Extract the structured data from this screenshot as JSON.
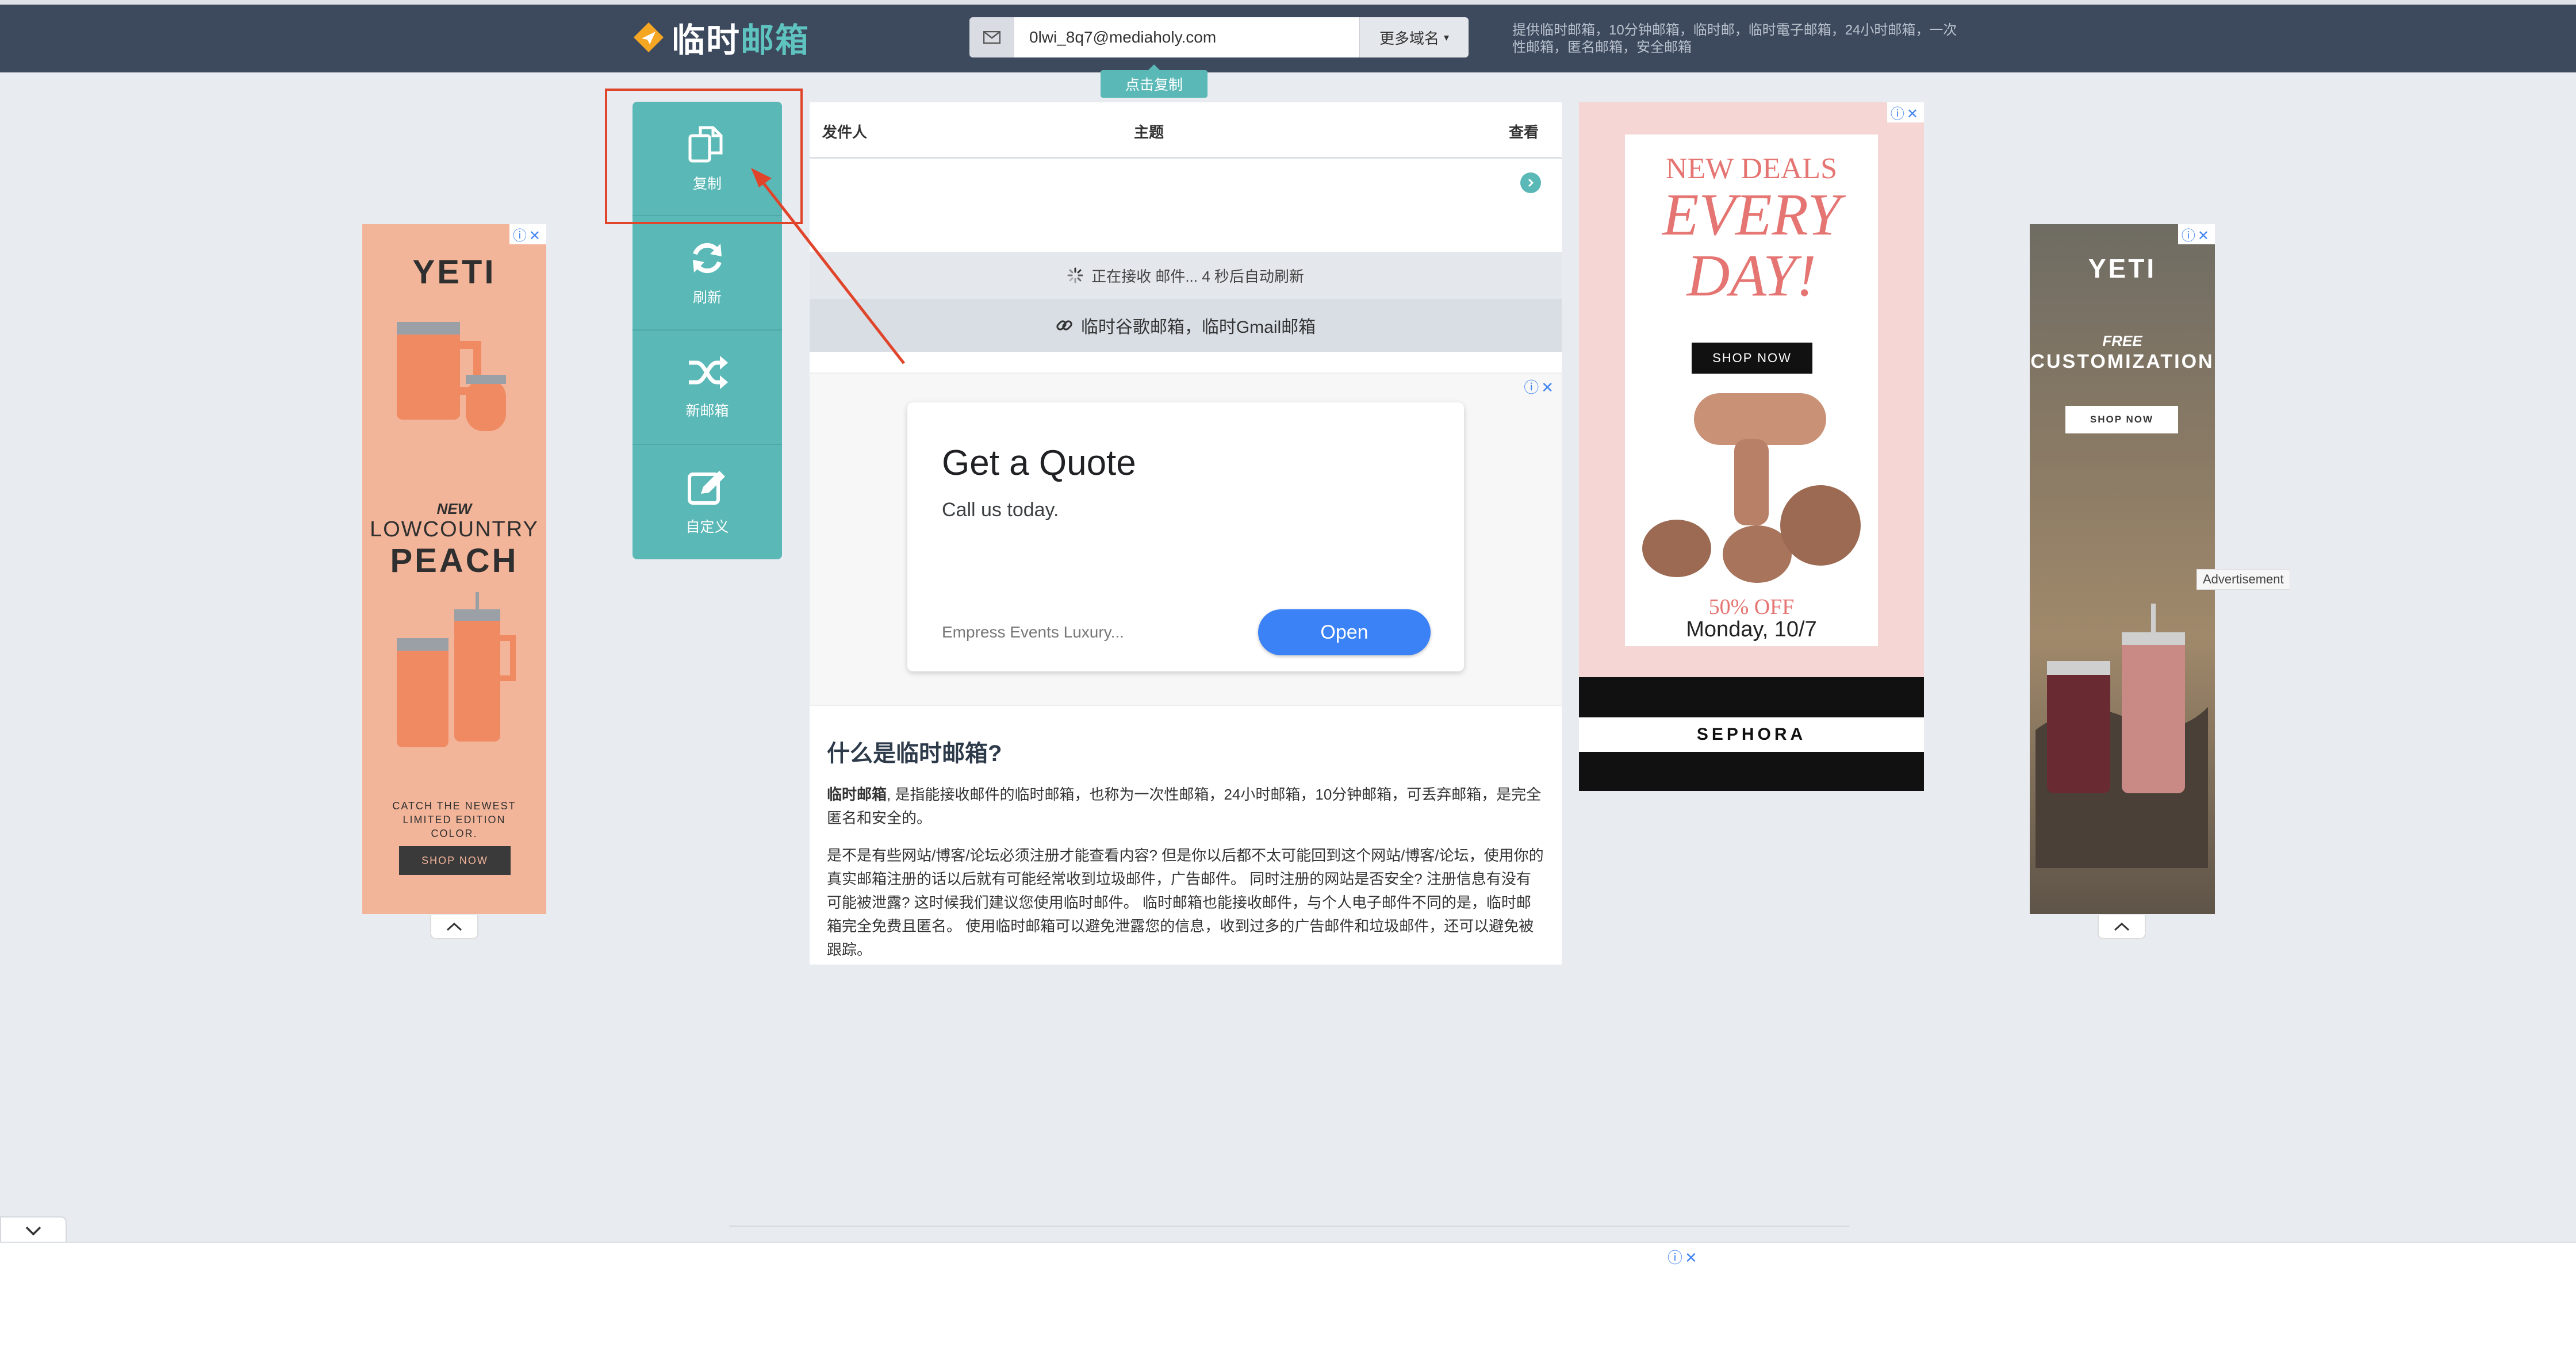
{
  "header": {
    "logo_part1": "临时",
    "logo_part2": "邮箱",
    "email_value": "0lwi_8q7@mediaholy.com",
    "more_domains": "更多域名",
    "copy_tip": "点击复制",
    "description": "提供临时邮箱，10分钟邮箱，临时邮，临时電子邮箱，24小时邮箱，一次性邮箱，匿名邮箱，安全邮箱"
  },
  "sidenav": {
    "items": [
      {
        "label": "复制",
        "icon": "copy-icon"
      },
      {
        "label": "刷新",
        "icon": "refresh-icon"
      },
      {
        "label": "新邮箱",
        "icon": "shuffle-icon"
      },
      {
        "label": "自定义",
        "icon": "edit-icon"
      }
    ]
  },
  "mail": {
    "col_from": "发件人",
    "col_subject": "主题",
    "col_view": "查看",
    "status_text": "正在接收 邮件... 4 秒后自动刷新",
    "gmail_link": "临时谷歌邮箱，临时Gmail邮箱"
  },
  "quote_ad": {
    "title": "Get a Quote",
    "subtitle": "Call us today.",
    "brand": "Empress Events Luxury...",
    "button": "Open"
  },
  "about": {
    "heading": "什么是临时邮箱?",
    "p1_bold": "临时邮箱",
    "p1_rest": ", 是指能接收邮件的临时邮箱，也称为一次性邮箱，24小时邮箱，10分钟邮箱，可丢弃邮箱，是完全匿名和安全的。",
    "p2": "是不是有些网站/博客/论坛必须注册才能查看内容? 但是你以后都不太可能回到这个网站/博客/论坛，使用你的真实邮箱注册的话以后就有可能经常收到垃圾邮件，广告邮件。 同时注册的网站是否安全? 注册信息有没有可能被泄露? 这时候我们建议您使用临时邮件。 临时邮箱也能接收邮件，与个人电子邮件不同的是，临时邮箱完全免费且匿名。 使用临时邮箱可以避免泄露您的信息，收到过多的广告邮件和垃圾邮件，还可以避免被跟踪。"
  },
  "ads": {
    "left": {
      "brand": "YETI",
      "line1": "NEW",
      "line2": "LOWCOUNTRY",
      "line3": "PEACH",
      "line4": "CATCH THE NEWEST LIMITED EDITION COLOR.",
      "cta": "SHOP NOW"
    },
    "right": {
      "brand": "YETI",
      "line1": "FREE",
      "line2": "CUSTOMIZATION",
      "cta": "SHOP NOW",
      "tag": "Advertisement"
    },
    "middle": {
      "line1": "NEW DEALS",
      "line2": "EVERY",
      "line3": "DAY!",
      "cta": "SHOP NOW",
      "discount": "50% OFF",
      "date": "Monday, 10/7",
      "brand": "SEPHORA"
    }
  },
  "colors": {
    "header_bg": "#3d4a5e",
    "accent": "#5ab8b6",
    "highlight": "#e0452b"
  }
}
